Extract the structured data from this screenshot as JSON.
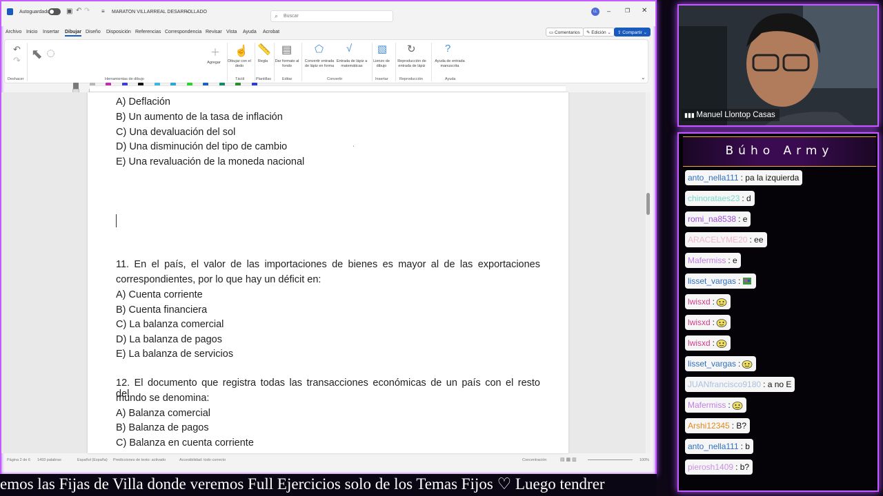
{
  "word": {
    "autosave_label": "Autoguardado",
    "doc_title": "MARATON VILLARREAL DESARROLLADO",
    "title_chevron": "⌄",
    "search_placeholder": "Buscar",
    "avatar_initials": "LL",
    "tabs": [
      "Archivo",
      "Inicio",
      "Insertar",
      "Dibujar",
      "Diseño",
      "Disposición",
      "Referencias",
      "Correspondencia",
      "Revisar",
      "Vista",
      "Ayuda",
      "Acrobat"
    ],
    "comments_label": "Comentarios",
    "edit_label": "Edición",
    "share_label": "Compartir",
    "ribbon": {
      "undo_label": "Deshacer",
      "drawing_tools_label": "Herramientas de dibujo",
      "add_label": "Agregar",
      "draw_finger_label": "Dibujar con el dedo",
      "ruler_label": "Regla",
      "format_bg_label": "Dar formato al fondo",
      "convert_shape_label": "Convertir entrada de lápiz en forma",
      "math_label": "Entrada de lápiz a matemáticas",
      "canvas_label": "Lienzo de dibujo",
      "replay_label": "Reproducción de entrada de lápiz",
      "help_label": "Ayuda de entrada manuscrita",
      "groups": [
        "Táctil",
        "Plantillas",
        "Editar",
        "Convertir",
        "Insertar",
        "Reproducción",
        "Ayuda"
      ]
    },
    "pen_colors": [
      "#7a7a7a",
      "#b8b8b8",
      "#c52ba8",
      "#3c3cd6",
      "#111111",
      "#3fb6e0",
      "#2aa7d8",
      "#2bd32b",
      "#1f5fbf",
      "#138a6b",
      "#2e8b2e",
      "#2a3fd0"
    ],
    "document_lines": [
      "A) Deflación",
      "B) Un aumento de la tasa de inflación",
      "C) Una devaluación del sol",
      "D) Una disminución del tipo de cambio",
      "E) Una revaluación de la moneda nacional",
      "11.  En  el  país,  el  valor  de  las  importaciones  de  bienes  es  mayor  al  de  las  exportaciones",
      "correspondientes, por lo que hay un déficit en:",
      "A) Cuenta corriente",
      "B) Cuenta financiera",
      "C) La balanza comercial",
      "D) La balanza de pagos",
      "E) La balanza de servicios",
      "12.  El  documento  que  registra  todas  las  transacciones  económicas  de  un  país  con  el  resto  del",
      "mundo se denomina:",
      "A) Balanza comercial",
      "B) Balanza de pagos",
      "C) Balanza en cuenta corriente"
    ],
    "status": {
      "page": "Página 2 de 6",
      "words": "1493 palabras",
      "language": "Español (España)",
      "predictions": "Predicciones de texto: activado",
      "accessibility": "Accesibilidad: todo correcto",
      "focus": "Concentración",
      "zoom": "100%"
    }
  },
  "ticker_text": "emos las Fijas de Villa donde veremos Full Ejercicios solo de los Temas Fijos    ♡   Luego tendrer",
  "webcam": {
    "name": "Manuel Llontop Casas"
  },
  "chat": {
    "title": "Búho Army",
    "messages": [
      {
        "user": "anto_nella111",
        "color": "#2f6fbf",
        "text": ": pa la izquierda",
        "emote": ""
      },
      {
        "user": "chinorataes23",
        "color": "#7ad8c8",
        "text": ": d",
        "emote": ""
      },
      {
        "user": "romi_na8538",
        "color": "#9a4fd6",
        "text": ": e",
        "emote": ""
      },
      {
        "user": "ARACELYME20",
        "color": "#f0b8c8",
        "text": ": ee",
        "emote": ""
      },
      {
        "user": "Mafermiss",
        "color": "#c080e0",
        "text": ": e",
        "emote": ""
      },
      {
        "user": "lisset_vargas",
        "color": "#2f6fbf",
        "text": ":",
        "emote": "pixel-emote"
      },
      {
        "user": "lwisxd",
        "color": "#d0408a",
        "text": ":",
        "emote": "face-emote"
      },
      {
        "user": "lwisxd",
        "color": "#d0408a",
        "text": ":",
        "emote": "face-emote"
      },
      {
        "user": "lwisxd",
        "color": "#d0408a",
        "text": ":",
        "emote": "face-emote"
      },
      {
        "user": "lisset_vargas",
        "color": "#2f6fbf",
        "text": ":",
        "emote": "face-emote"
      },
      {
        "user": "JUANfrancisco9180",
        "color": "#a8c0e0",
        "text": ": a no E",
        "emote": ""
      },
      {
        "user": "Mafermiss",
        "color": "#c080e0",
        "text": ":",
        "emote": "face-emote"
      },
      {
        "user": "Arshi12345",
        "color": "#e08a20",
        "text": ": B?",
        "emote": ""
      },
      {
        "user": "anto_nella111",
        "color": "#2f6fbf",
        "text": ": b",
        "emote": ""
      },
      {
        "user": "pierosh1409",
        "color": "#c890e0",
        "text": ": b?",
        "emote": ""
      }
    ]
  }
}
